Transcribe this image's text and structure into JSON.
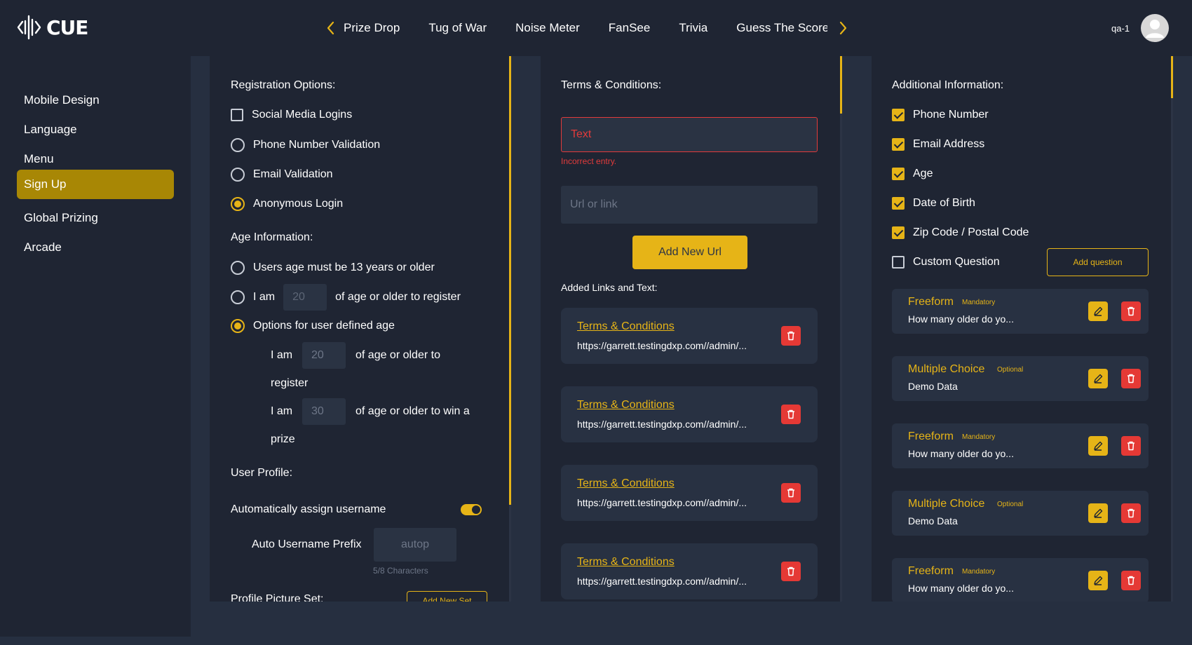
{
  "header": {
    "logo_text": "CUE",
    "tabs": [
      "Prize Drop",
      "Tug of War",
      "Noise Meter",
      "FanSee",
      "Trivia",
      "Guess The Score"
    ],
    "user_name": "qa-1",
    "accent": "#e6b417"
  },
  "sidebar": {
    "items": [
      "Mobile Design",
      "Language",
      "Menu",
      "Sign Up",
      "Global Prizing",
      "Arcade"
    ],
    "active": "Sign Up"
  },
  "registration": {
    "title": "Registration Options:",
    "options": [
      {
        "label": "Social Media Logins",
        "type": "checkbox",
        "checked": false
      },
      {
        "label": "Phone Number Validation",
        "type": "radio",
        "checked": false
      },
      {
        "label": "Email Validation",
        "type": "radio",
        "checked": false
      },
      {
        "label": "Anonymous Login",
        "type": "radio",
        "checked": true
      }
    ]
  },
  "age": {
    "title": "Age Information:",
    "option1": "Users age must be 13 years or older",
    "option2_prefix": "I am",
    "option2_value": "20",
    "option2_suffix": "of age or older to register",
    "option3": "Options for user defined age",
    "sub1_prefix": "I am",
    "sub1_value": "20",
    "sub1_suffix": "of age or older to",
    "sub1_wrap": "register",
    "sub2_prefix": "I am",
    "sub2_value": "30",
    "sub2_suffix": "of age or older to win a",
    "sub2_wrap": "prize"
  },
  "profile": {
    "title": "User Profile:",
    "auto_label": "Automatically assign username",
    "auto_on": true,
    "prefix_label": "Auto Username Prefix",
    "prefix_value": "autop",
    "char_count": "5/8 Characters",
    "picture_label": "Profile Picture Set:",
    "add_set_label": "Add New Set"
  },
  "terms": {
    "title": "Terms & Conditions:",
    "text_placeholder": "Text",
    "error": "Incorrect entry.",
    "url_placeholder": "Url or link",
    "add_url_label": "Add New Url",
    "added_title": "Added Links and Text:",
    "links": [
      {
        "title": "Terms & Conditions",
        "url": "https://garrett.testingdxp.com//admin/..."
      },
      {
        "title": "Terms & Conditions",
        "url": "https://garrett.testingdxp.com//admin/..."
      },
      {
        "title": "Terms & Conditions",
        "url": "https://garrett.testingdxp.com//admin/..."
      },
      {
        "title": "Terms & Conditions",
        "url": "https://garrett.testingdxp.com//admin/..."
      }
    ]
  },
  "additional": {
    "title": "Additional Information:",
    "fields": [
      {
        "label": "Phone Number",
        "checked": true
      },
      {
        "label": "Email Address",
        "checked": true
      },
      {
        "label": "Age",
        "checked": true
      },
      {
        "label": "Date of Birth",
        "checked": true
      },
      {
        "label": "Zip Code / Postal Code",
        "checked": true
      },
      {
        "label": "Custom Question",
        "checked": false
      }
    ],
    "add_question_label": "Add question",
    "questions": [
      {
        "type": "Freeform",
        "tag": "Mandatory",
        "text": "How many older do yo..."
      },
      {
        "type": "Multiple Choice",
        "tag": "Optional",
        "text": "Demo Data"
      },
      {
        "type": "Freeform",
        "tag": "Mandatory",
        "text": "How many older do yo..."
      },
      {
        "type": "Multiple Choice",
        "tag": "Optional",
        "text": "Demo Data"
      },
      {
        "type": "Freeform",
        "tag": "Mandatory",
        "text": "How many older do yo..."
      }
    ]
  }
}
